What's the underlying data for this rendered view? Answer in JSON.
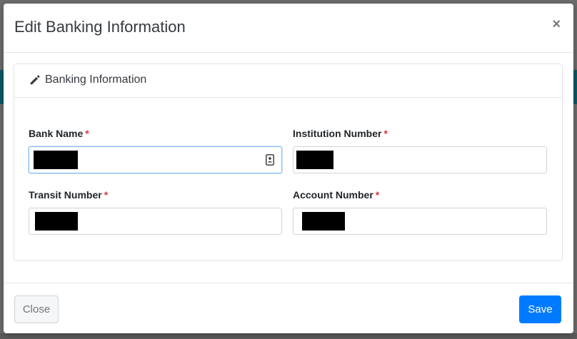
{
  "modal": {
    "title": "Edit Banking Information",
    "close_symbol": "×"
  },
  "card": {
    "title": "Banking Information",
    "icon": "pencil-icon"
  },
  "fields": {
    "bank_name": {
      "label": "Bank Name",
      "required_marker": "*",
      "value": ""
    },
    "institution_number": {
      "label": "Institution Number",
      "required_marker": "*",
      "value": ""
    },
    "transit_number": {
      "label": "Transit Number",
      "required_marker": "*",
      "value": ""
    },
    "account_number": {
      "label": "Account Number",
      "required_marker": "*",
      "value": ""
    }
  },
  "footer": {
    "close_label": "Close",
    "save_label": "Save"
  },
  "colors": {
    "primary": "#007bff",
    "required": "#dc3545",
    "focus_border": "#80bdff"
  }
}
